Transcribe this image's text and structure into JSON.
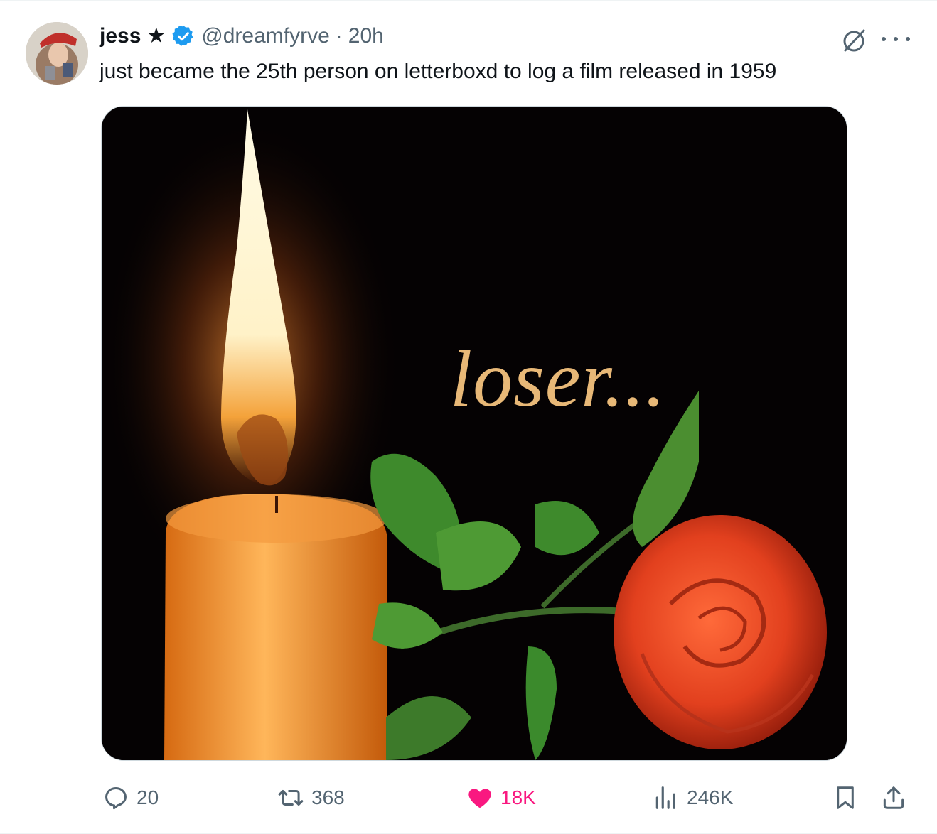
{
  "author": {
    "display_name": "jess",
    "star_icon": "star-icon",
    "verified_icon": "verified-badge-icon",
    "handle": "@dreamfyrve",
    "separator": "·",
    "time": "20h"
  },
  "header_icons": {
    "grok": "grok-icon",
    "more": "more-icon"
  },
  "tweet": {
    "text": "just became the 25th person on letterboxd to log a film released in 1959"
  },
  "media": {
    "caption": "loser...",
    "depicts": [
      "candle-icon",
      "rose-icon"
    ]
  },
  "actions": {
    "reply": {
      "icon": "reply-icon",
      "count": "20"
    },
    "repost": {
      "icon": "repost-icon",
      "count": "368"
    },
    "like": {
      "icon": "heart-icon",
      "count": "18K",
      "color": "#f91880"
    },
    "views": {
      "icon": "views-icon",
      "count": "246K"
    },
    "bookmark": {
      "icon": "bookmark-icon"
    },
    "share": {
      "icon": "share-icon"
    }
  },
  "colors": {
    "text_primary": "#0f1419",
    "text_secondary": "#536471",
    "verified": "#1d9bf0",
    "like": "#f91880",
    "caption": "#e8b877"
  }
}
